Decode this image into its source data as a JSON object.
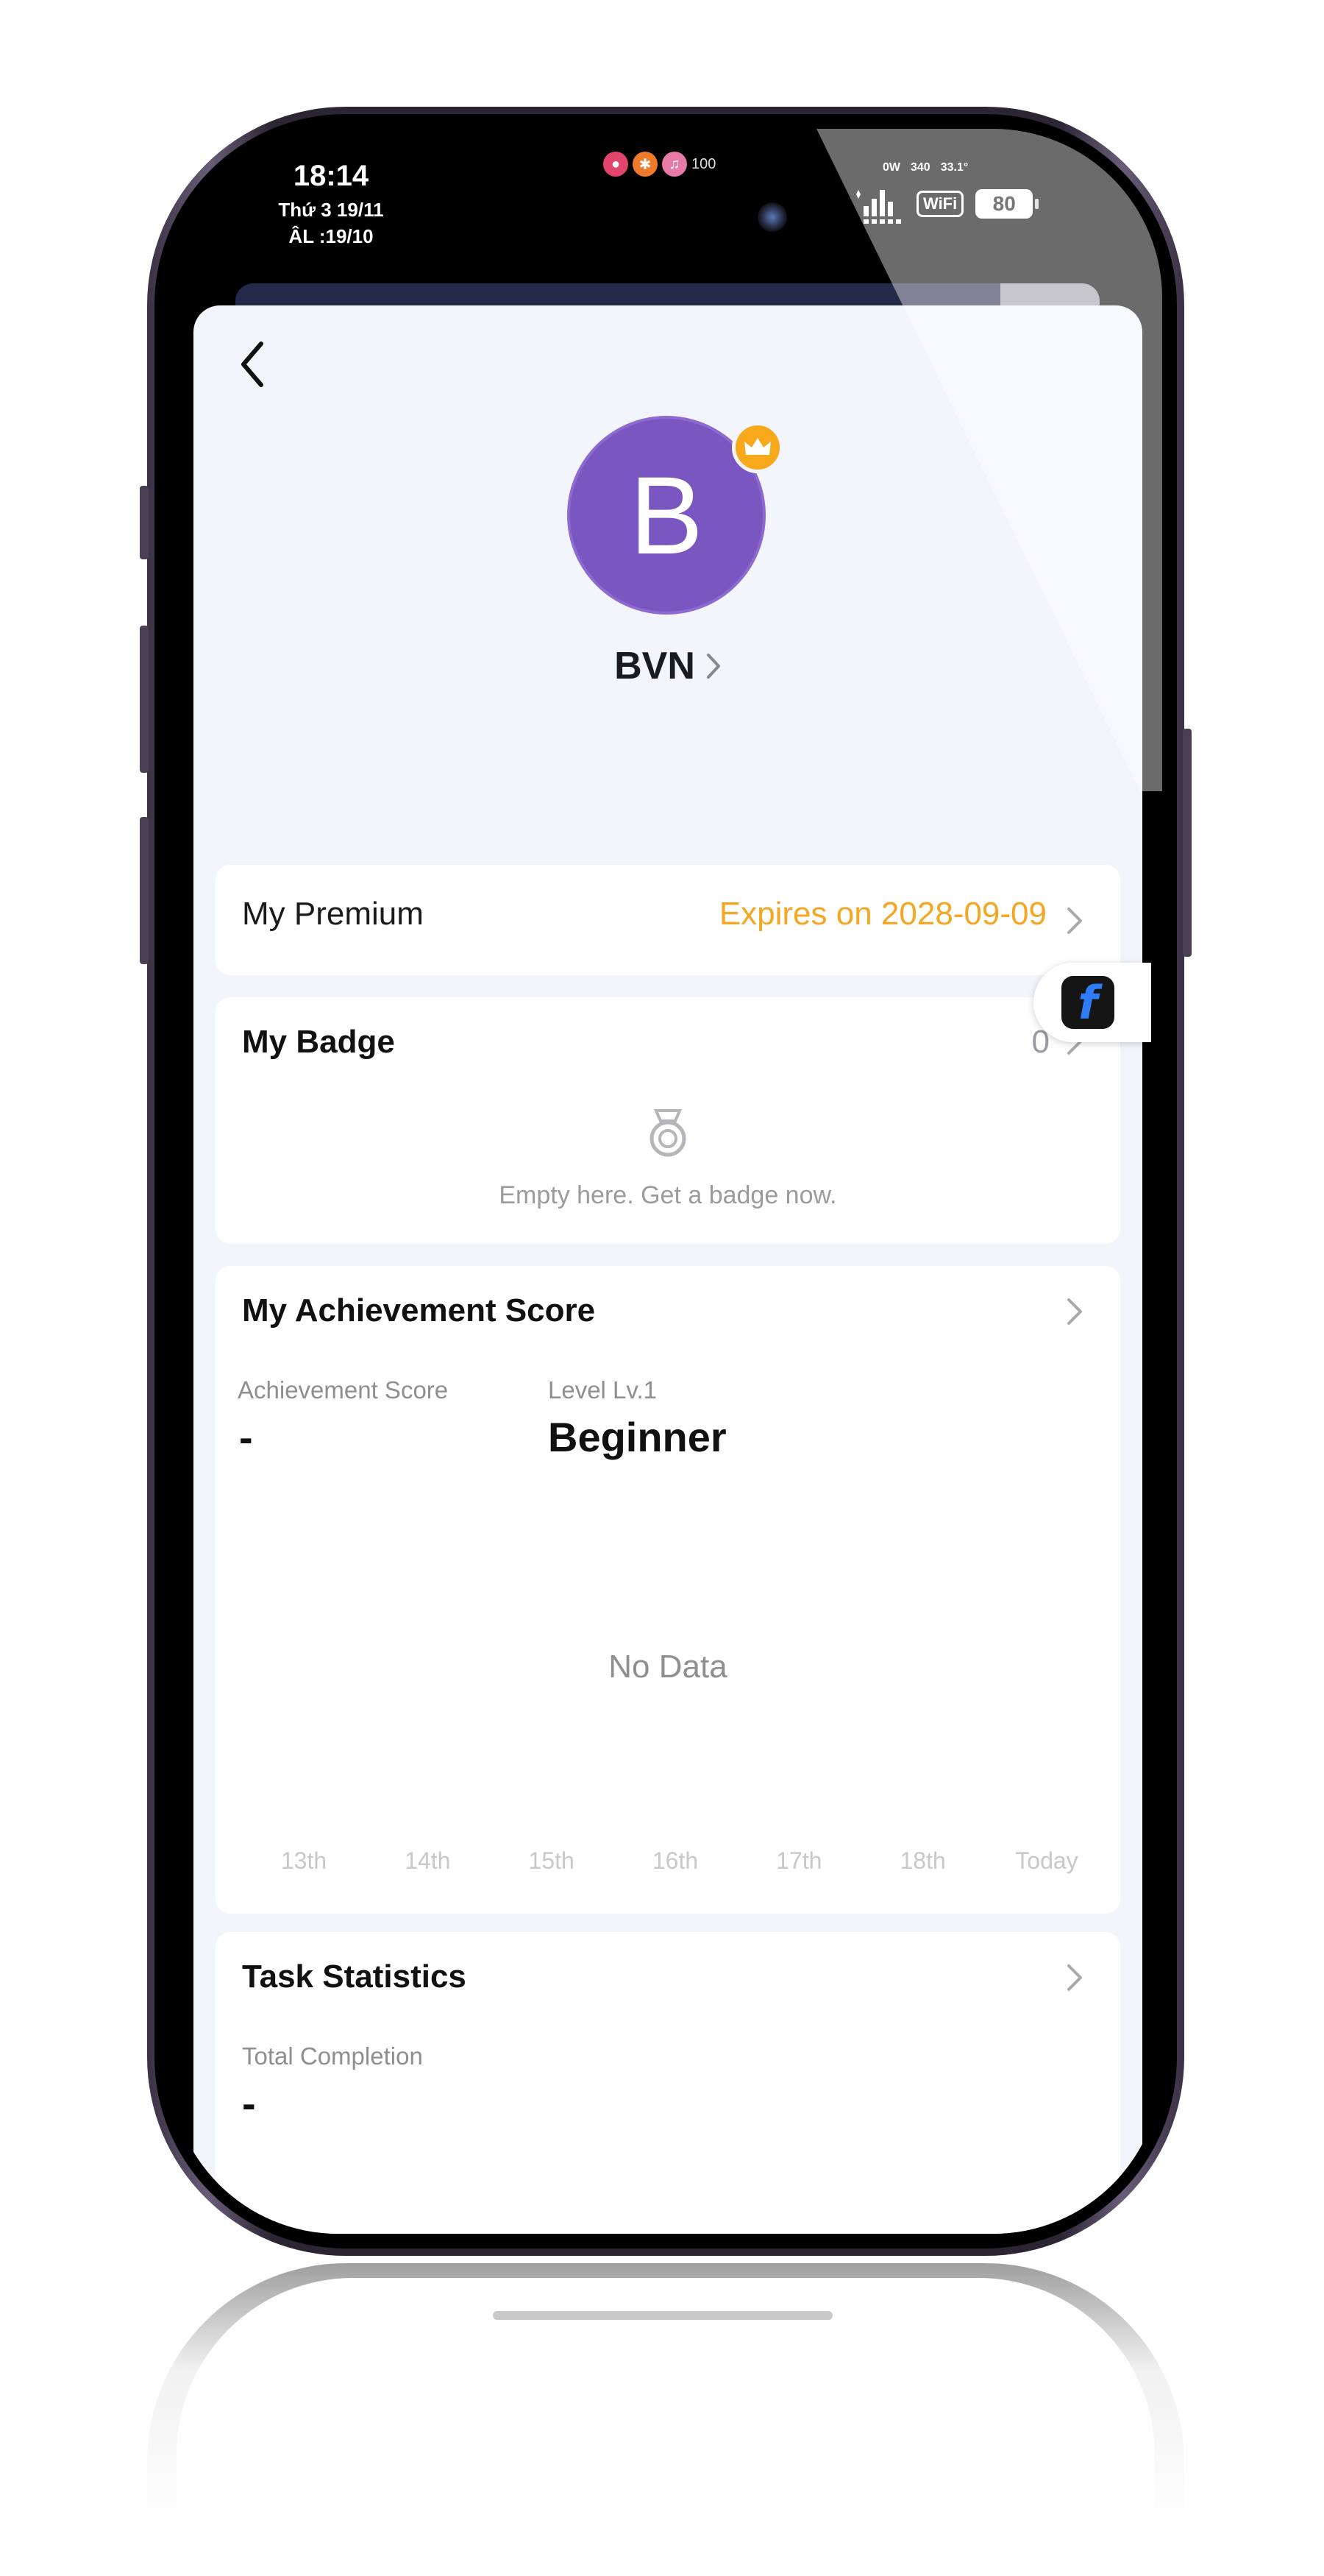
{
  "status_bar": {
    "time": "18:14",
    "date_line1": "Thứ 3 19/11",
    "date_line2": "ÂL :19/10",
    "volume_level": "100",
    "power": "0W",
    "data_speed": "340",
    "temperature": "33.1°",
    "wifi_label": "WiFi",
    "battery": "80",
    "icons": [
      "lock-icon",
      "bluetooth-icon",
      "volume-icon",
      "signal-icon",
      "wifi-icon",
      "battery-icon"
    ]
  },
  "profile": {
    "avatar_letter": "B",
    "username": "BVN",
    "avatar_color": "#7a56c0",
    "crown_color": "#f7a81b"
  },
  "premium": {
    "label": "My Premium",
    "value": "Expires on 2028-09-09",
    "value_color": "#f5a623"
  },
  "badge": {
    "title": "My Badge",
    "count": "0",
    "empty_text": "Empty here. Get a badge now."
  },
  "achievement": {
    "title": "My Achievement Score",
    "score_label": "Achievement Score",
    "score_value": "-",
    "level_label": "Level Lv.1",
    "level_value": "Beginner",
    "no_data": "No Data"
  },
  "chart_data": {
    "type": "line",
    "categories": [
      "13th",
      "14th",
      "15th",
      "16th",
      "17th",
      "18th",
      "Today"
    ],
    "series": [],
    "title": "",
    "xlabel": "",
    "ylabel": "",
    "grid": false
  },
  "tasks": {
    "title": "Task Statistics",
    "completion_label": "Total Completion",
    "completion_value": "-"
  }
}
